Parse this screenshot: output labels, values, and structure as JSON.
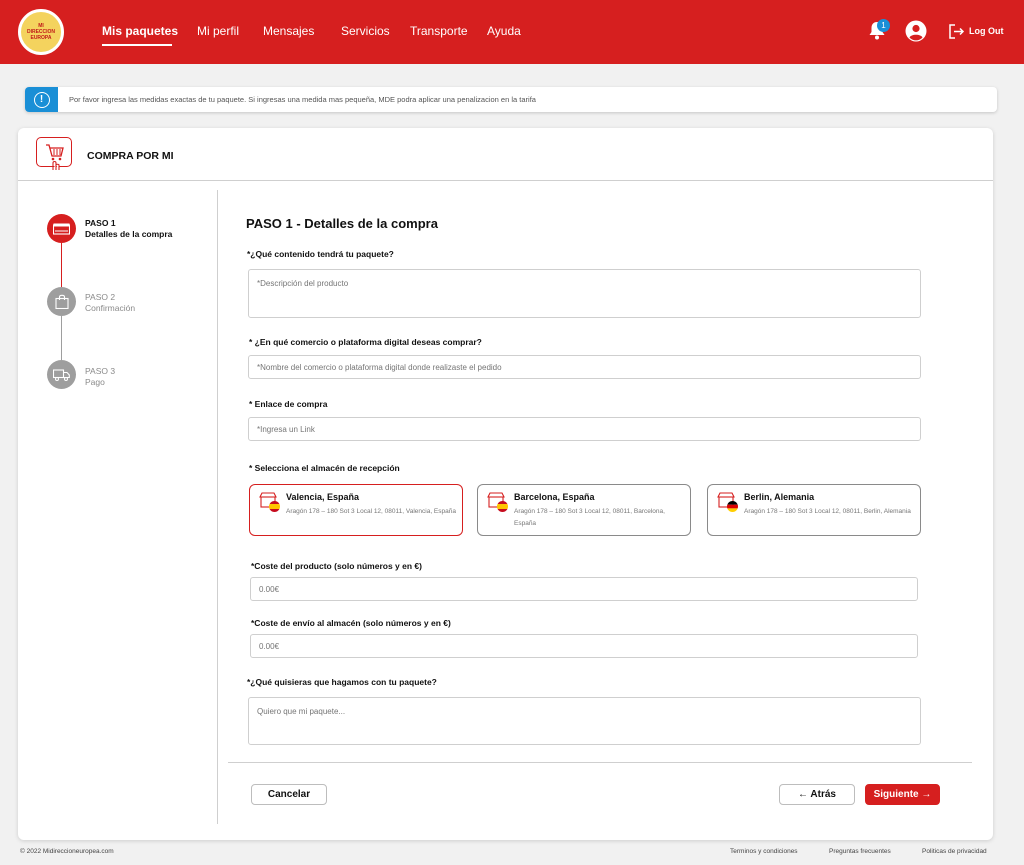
{
  "header": {
    "logo_text": "MI DIRECCION EUROPA",
    "nav": [
      {
        "label": "Mis paquetes",
        "active": true
      },
      {
        "label": "Mi perfil",
        "active": false
      },
      {
        "label": "Mensajes",
        "active": false
      },
      {
        "label": "Servicios",
        "active": false
      },
      {
        "label": "Transporte",
        "active": false
      },
      {
        "label": "Ayuda",
        "active": false
      }
    ],
    "notification_count": "1",
    "logout_label": "Log Out"
  },
  "banner": {
    "text": "Por favor ingresa las medidas exactas de tu paquete. Si ingresas una medida mas pequeña, MDE podra aplicar una penalizacion en la tarifa",
    "icon": "info-icon"
  },
  "card": {
    "title": "COMPRA POR MI"
  },
  "steps": [
    {
      "number": "PASO 1",
      "name": "Detalles de la compra",
      "icon": "storefront-icon",
      "active": true
    },
    {
      "number": "PASO 2",
      "name": "Confirmación",
      "icon": "bag-icon",
      "active": false
    },
    {
      "number": "PASO 3",
      "name": "Pago",
      "icon": "truck-icon",
      "active": false
    }
  ],
  "form": {
    "title": "PASO 1 - Detalles de la compra",
    "content_label": "*¿Qué contenido tendrá tu paquete?",
    "content_placeholder": "*Descripción del producto",
    "store_label": "* ¿En qué comercio o plataforma digital deseas comprar?",
    "store_placeholder": "*Nombre del comercio o plataforma digital donde realizaste el pedido",
    "link_label": "* Enlace de compra",
    "link_placeholder": "*Ingresa un Link",
    "warehouse_label": "* Selecciona el almacén de recepción",
    "warehouses": [
      {
        "name": "Valencia, España",
        "address": "Aragón 178 – 180 Sot 3 Local 12, 08011, Valencia, España",
        "flag": "spain-flag",
        "selected": true
      },
      {
        "name": "Barcelona, España",
        "address": "Aragón 178 – 180 Sot 3 Local 12, 08011, Barcelona, España",
        "flag": "spain-flag",
        "selected": false
      },
      {
        "name": "Berlin, Alemania",
        "address": "Aragón 178 – 180 Sot 3 Local 12, 08011, Berlin, Alemania",
        "flag": "germany-flag",
        "selected": false
      }
    ],
    "product_cost_label": "*Coste del producto  (solo números y en €)",
    "product_cost_placeholder": "0.00€",
    "shipping_cost_label": "*Coste de envío al almacén  (solo números y en €)",
    "shipping_cost_placeholder": "0.00€",
    "instructions_label": "*¿Qué quisieras que hagamos con tu paquete?",
    "instructions_placeholder": "Quiero que mi paquete..."
  },
  "actions": {
    "cancel": "Cancelar",
    "back": "← Atrás",
    "next": "Siguiente →"
  },
  "footer": {
    "copyright": "© 2022 Midireccioneuropea.com",
    "links": [
      "Terminos y condiciones",
      "Preguntas frecuentes",
      "Politicas de privacidad"
    ]
  },
  "colors": {
    "brand_red": "#d61f1f",
    "info_blue": "#1a8fd6",
    "inactive_gray": "#9e9e9e"
  }
}
